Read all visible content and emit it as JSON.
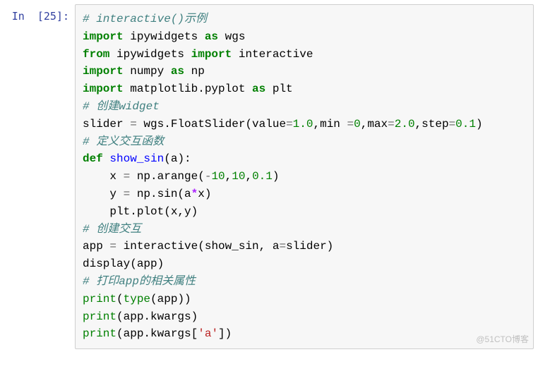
{
  "prompt": "In  [25]:",
  "watermark": "@51CTO博客",
  "lines": {
    "l1_comment": "# interactive()示例",
    "l2_kw1": "import",
    "l2_mod": " ipywidgets ",
    "l2_kw2": "as",
    "l2_alias": " wgs",
    "l3_kw1": "from",
    "l3_mod": " ipywidgets ",
    "l3_kw2": "import",
    "l3_name": " interactive",
    "l4_kw1": "import",
    "l4_mod": " numpy ",
    "l4_kw2": "as",
    "l4_alias": " np",
    "l5_kw1": "import",
    "l5_mod": " matplotlib.pyplot ",
    "l5_kw2": "as",
    "l5_alias": " plt",
    "l6_comment": "# 创建widget",
    "l7_a": "slider ",
    "l7_eq": "=",
    "l7_b": " wgs.FloatSlider(value",
    "l7_eq2": "=",
    "l7_n1": "1.0",
    "l7_c": ",min ",
    "l7_eq3": "=",
    "l7_n2": "0",
    "l7_d": ",max",
    "l7_eq4": "=",
    "l7_n3": "2.0",
    "l7_e": ",step",
    "l7_eq5": "=",
    "l7_n4": "0.1",
    "l7_f": ")",
    "l8_comment": "# 定义交互函数",
    "l9_kw": "def",
    "l9_sp": " ",
    "l9_fn": "show_sin",
    "l9_p": "(a):",
    "l10_ind": "    ",
    "l10_a": "x ",
    "l10_eq": "=",
    "l10_b": " np.arange(",
    "l10_n1": "-",
    "l10_n1b": "10",
    "l10_c": ",",
    "l10_n2": "10",
    "l10_d": ",",
    "l10_n3": "0.1",
    "l10_e": ")",
    "l11_ind": "    ",
    "l11_a": "y ",
    "l11_eq": "=",
    "l11_b": " np.sin(a",
    "l11_star": "*",
    "l11_c": "x)",
    "l12_ind": "    ",
    "l12_a": "plt.plot(x,y)",
    "l13_comment": "# 创建交互",
    "l14_a": "app ",
    "l14_eq": "=",
    "l14_b": " interactive(show_sin, a",
    "l14_eq2": "=",
    "l14_c": "slider)",
    "l15_a": "display(app)",
    "l16_comment": "# 打印app的相关属性",
    "l17_a": "print",
    "l17_b": "(",
    "l17_c": "type",
    "l17_d": "(app))",
    "l18_a": "print",
    "l18_b": "(app.kwargs)",
    "l19_a": "print",
    "l19_b": "(app.kwargs[",
    "l19_s": "'a'",
    "l19_c": "])"
  }
}
